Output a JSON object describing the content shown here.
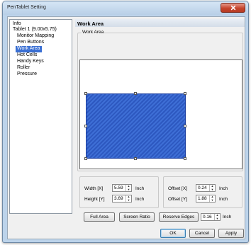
{
  "window": {
    "title": "PenTablet Setting"
  },
  "tree": {
    "items": [
      {
        "label": "Info",
        "indent": 0,
        "selected": false
      },
      {
        "label": "Tablet 1 (9.00x5.75)",
        "indent": 0,
        "selected": false
      },
      {
        "label": "Monitor Mapping",
        "indent": 1,
        "selected": false
      },
      {
        "label": "Pen Buttons",
        "indent": 1,
        "selected": false
      },
      {
        "label": "Work Area",
        "indent": 1,
        "selected": true
      },
      {
        "label": "Hot Cells",
        "indent": 1,
        "selected": false
      },
      {
        "label": "Handy Keys",
        "indent": 1,
        "selected": false
      },
      {
        "label": "Roller",
        "indent": 1,
        "selected": false
      },
      {
        "label": "Pressure",
        "indent": 1,
        "selected": false
      }
    ]
  },
  "panel": {
    "title": "Work Area",
    "group_label": "Work Area",
    "work_area_color": "#3e6fd6"
  },
  "size": {
    "width_label": "Width [X]",
    "width_value": "5.59",
    "width_unit": "Inch",
    "height_label": "Height [Y]",
    "height_value": "3.69",
    "height_unit": "Inch"
  },
  "offset": {
    "x_label": "Offset [X]",
    "x_value": "0.24",
    "x_unit": "Inch",
    "y_label": "Offset [Y]",
    "y_value": "1.88",
    "y_unit": "Inch"
  },
  "actions": {
    "full_area": "Full Area",
    "screen_ratio": "Screen Ratio",
    "reserve_edges": "Reserve Edges",
    "reserve_value": "0.16",
    "reserve_unit": "Inch"
  },
  "footer": {
    "ok": "OK",
    "cancel": "Cancel",
    "apply": "Apply"
  }
}
